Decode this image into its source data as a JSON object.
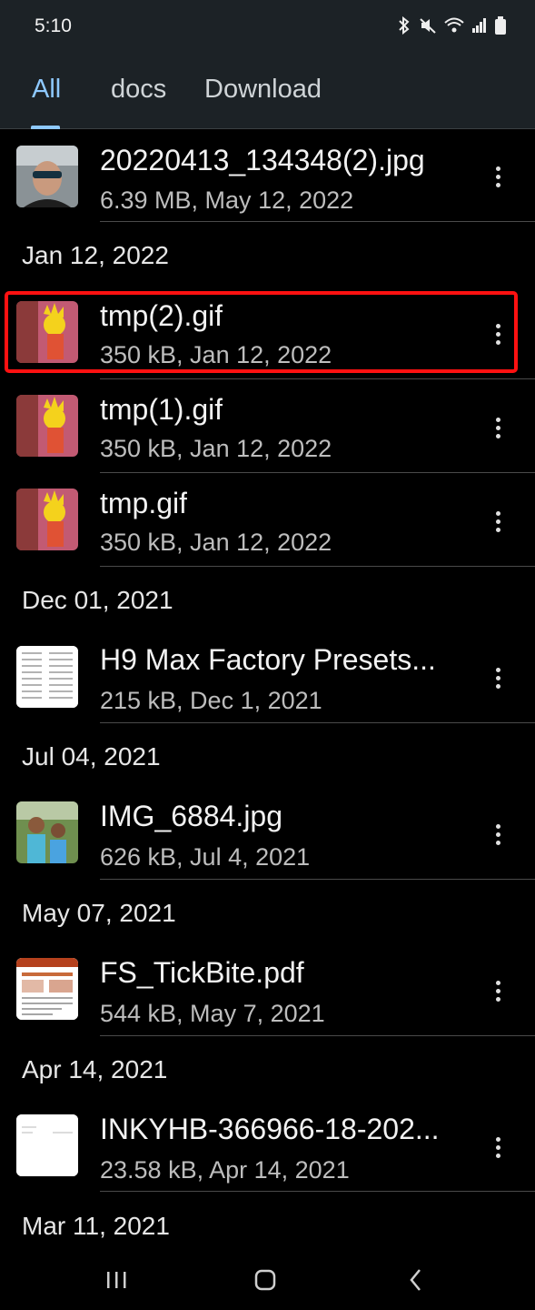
{
  "status_bar": {
    "time": "5:10"
  },
  "tabs": [
    {
      "label": "All",
      "active": true
    },
    {
      "label": "docs",
      "active": false
    },
    {
      "label": "Download",
      "active": false
    }
  ],
  "sections": [
    {
      "date": "",
      "files": [
        {
          "name": "20220413_134348(2).jpg",
          "meta": "6.39 MB, May 12, 2022",
          "thumb": "photo-man-icon"
        }
      ]
    },
    {
      "date": "Jan 12, 2022",
      "files": [
        {
          "name": "tmp(2).gif",
          "meta": "350 kB, Jan 12, 2022",
          "thumb": "gif-cartoon-icon",
          "highlighted": true
        },
        {
          "name": "tmp(1).gif",
          "meta": "350 kB, Jan 12, 2022",
          "thumb": "gif-cartoon-icon"
        },
        {
          "name": "tmp.gif",
          "meta": "350 kB, Jan 12, 2022",
          "thumb": "gif-cartoon-icon"
        }
      ]
    },
    {
      "date": "Dec 01, 2021",
      "files": [
        {
          "name": "H9 Max Factory Presets...",
          "meta": "215 kB, Dec 1, 2021",
          "thumb": "document-icon"
        }
      ]
    },
    {
      "date": "Jul 04, 2021",
      "files": [
        {
          "name": "IMG_6884.jpg",
          "meta": "626 kB, Jul 4, 2021",
          "thumb": "photo-kids-icon"
        }
      ]
    },
    {
      "date": "May 07, 2021",
      "files": [
        {
          "name": "FS_TickBite.pdf",
          "meta": "544 kB, May 7, 2021",
          "thumb": "pdf-icon"
        }
      ]
    },
    {
      "date": "Apr 14, 2021",
      "files": [
        {
          "name": "INKYHB-366966-18-202...",
          "meta": "23.58 kB, Apr 14, 2021",
          "thumb": "document-icon"
        }
      ]
    },
    {
      "date": "Mar 11, 2021",
      "files": []
    }
  ],
  "colors": {
    "accent": "#8ec9ff",
    "highlight": "#ff1111",
    "background": "#000000",
    "bar": "#1c2226"
  }
}
